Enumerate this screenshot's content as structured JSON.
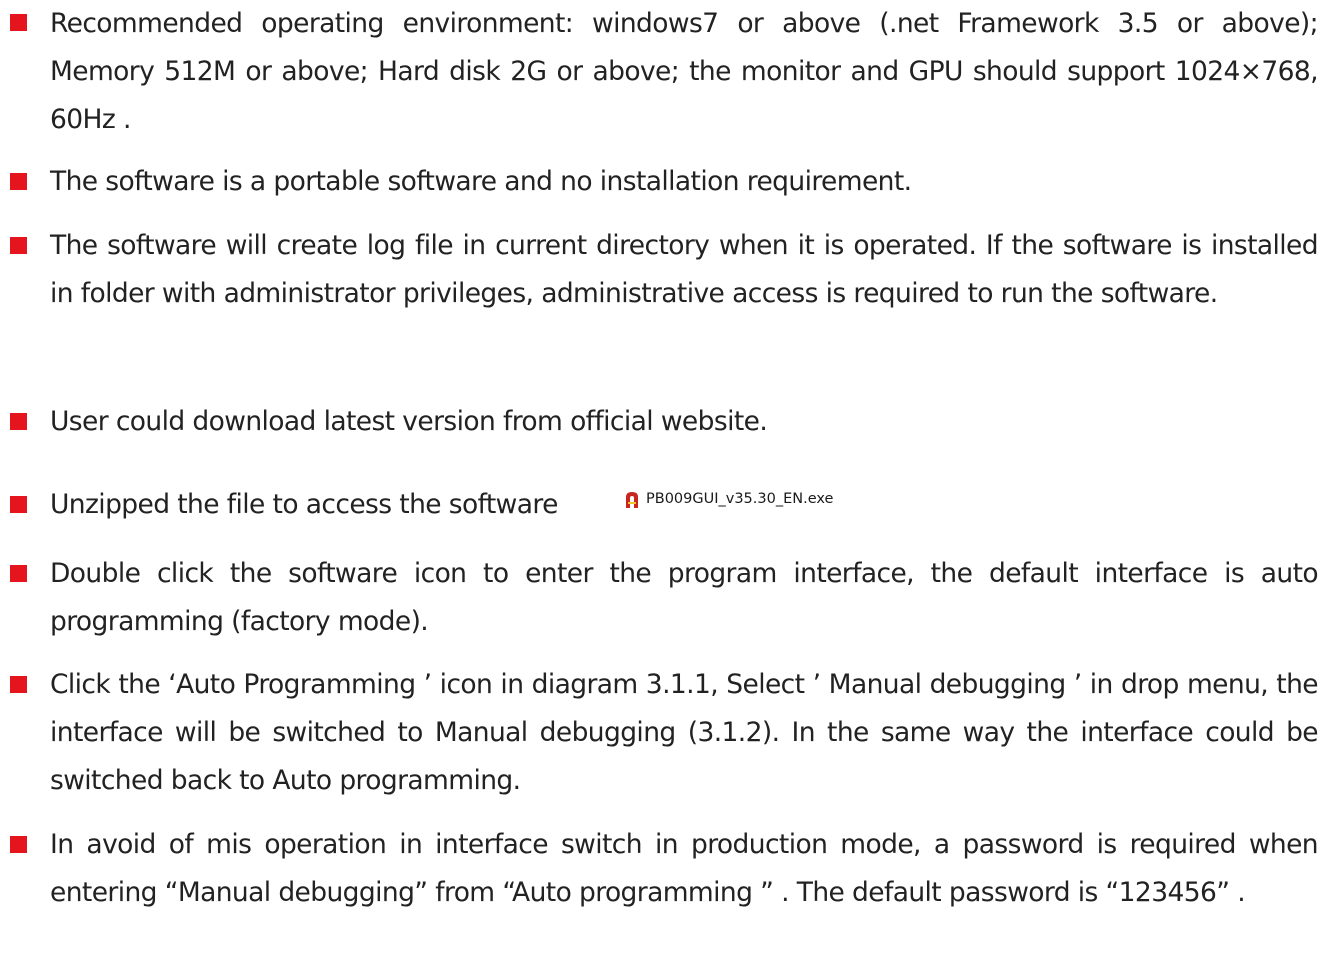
{
  "bullet_color": "#e4151d",
  "items": [
    {
      "text": "Recommended operating environment: windows7 or above (.net Framework 3.5 or above); Memory 512M or above; Hard disk 2G or above; the monitor and GPU should support 1024×768, 60Hz ."
    },
    {
      "text": "The software is a portable software and no installation requirement."
    },
    {
      "text": "The software will create log file in current directory when it is operated. If the software is installed in folder with administrator privileges, administrative access is required to run the software."
    },
    {
      "text": "User could download latest version from official website."
    },
    {
      "text": "Unzipped the file to access the software",
      "file_name": "PB009GUI_v35.30_EN.exe",
      "file_icon": "app-exe-icon"
    },
    {
      "text": "Double click the software icon to enter the program interface, the default interface is auto programming (factory mode)."
    },
    {
      "text": "Click the ‘Auto Programming ’ icon in diagram 3.1.1, Select ’ Manual debugging ’ in drop menu, the interface will be switched to Manual debugging (3.1.2). In the same way the interface could be switched back to Auto programming."
    },
    {
      "text": "In avoid of mis operation in interface switch in production mode, a password is required when entering “Manual debugging” from “Auto programming ” . The default password is “123456” ."
    }
  ]
}
